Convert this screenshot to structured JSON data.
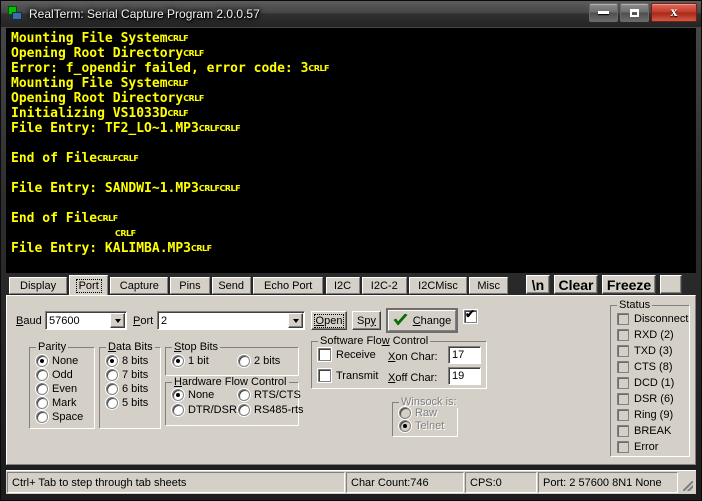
{
  "window": {
    "title": "RealTerm: Serial Capture Program 2.0.0.57",
    "icon": "realterm-icon",
    "minimize": "–",
    "maximize": "□",
    "close": "x"
  },
  "terminal": {
    "lines": [
      {
        "text": "Mounting File System",
        "ctl": "CRLF"
      },
      {
        "text": "Opening Root Directory",
        "ctl": "CRLF"
      },
      {
        "text": "Error: f_opendir failed, error code: 3",
        "ctl": "CRLF"
      },
      {
        "text": "Mounting File System",
        "ctl": "CRLF"
      },
      {
        "text": "Opening Root Directory",
        "ctl": "CRLF"
      },
      {
        "text": "Initializing VS1033D",
        "ctl": "CRLF"
      },
      {
        "text": "File Entry: TF2_LO~1.MP3",
        "ctl": "CRLFCRLF"
      },
      {
        "text": "",
        "ctl": ""
      },
      {
        "text": "End of File",
        "ctl": "CRLFCRLF"
      },
      {
        "text": "",
        "ctl": ""
      },
      {
        "text": "File Entry: SANDWI~1.MP3",
        "ctl": "CRLFCRLF"
      },
      {
        "text": "",
        "ctl": ""
      },
      {
        "text": "End of File",
        "ctl": "CRLF"
      },
      {
        "text": "",
        "ctl": "CRLF",
        "indent": 13
      },
      {
        "text": "File Entry: KALIMBA.MP3",
        "ctl": "CRLF"
      }
    ]
  },
  "tabs": [
    {
      "label": "Display",
      "active": false
    },
    {
      "label": "Port",
      "active": true
    },
    {
      "label": "Capture",
      "active": false
    },
    {
      "label": "Pins",
      "active": false
    },
    {
      "label": "Send",
      "active": false
    },
    {
      "label": "Echo Port",
      "active": false
    },
    {
      "label": "I2C",
      "active": false
    },
    {
      "label": "I2C-2",
      "active": false
    },
    {
      "label": "I2CMisc",
      "active": false
    },
    {
      "label": "Misc",
      "active": false
    }
  ],
  "toolbuttons": [
    {
      "label": "\\n",
      "name": "newline-button"
    },
    {
      "label": "Clear",
      "name": "clear-button"
    },
    {
      "label": "Freeze",
      "name": "freeze-button"
    },
    {
      "label": "",
      "name": "help-button"
    }
  ],
  "port": {
    "baud_label": "Baud",
    "baud_value": "57600",
    "port_label": "Port",
    "port_value": "2",
    "open_label": "Open",
    "spy_label": "Spy",
    "change_label": "Change",
    "change_check": true
  },
  "parity": {
    "title": "Parity",
    "options": [
      "None",
      "Odd",
      "Even",
      "Mark",
      "Space"
    ],
    "selected": "None"
  },
  "data_bits": {
    "title": "Data Bits",
    "options": [
      "8 bits",
      "7 bits",
      "6 bits",
      "5 bits"
    ],
    "selected": "8 bits"
  },
  "stop_bits": {
    "title": "Stop Bits",
    "options": [
      "1 bit",
      "2 bits"
    ],
    "selected": "1 bit"
  },
  "hardware_flow": {
    "title": "Hardware Flow Control",
    "options": [
      "None",
      "RTS/CTS",
      "DTR/DSR",
      "RS485-rts"
    ],
    "selected": "None"
  },
  "software_flow": {
    "title": "Software Flow Control",
    "receive_label": "Receive",
    "receive_checked": false,
    "transmit_label": "Transmit",
    "transmit_checked": false,
    "xon_label": "Xon Char:",
    "xon_value": "17",
    "xoff_label": "Xoff Char:",
    "xoff_value": "19"
  },
  "winsock": {
    "title": "Winsock is:",
    "options": [
      "Raw",
      "Telnet"
    ],
    "selected": "Telnet",
    "disabled": true
  },
  "status": {
    "title": "Status",
    "items": [
      "Disconnect",
      "RXD (2)",
      "TXD (3)",
      "CTS (8)",
      "DCD (1)",
      "DSR (6)",
      "Ring (9)",
      "BREAK",
      "Error"
    ]
  },
  "statusbar": {
    "hint": "Ctrl+ Tab to step through tab sheets",
    "char_count": "Char Count:746",
    "cps": "CPS:0",
    "port_info": "Port: 2 57600 8N1 None"
  },
  "colors": {
    "terminal_bg": "#000000",
    "terminal_fg": "#ffff00",
    "panel_bg": "#d4d0c8",
    "accent_check": "#008000"
  }
}
